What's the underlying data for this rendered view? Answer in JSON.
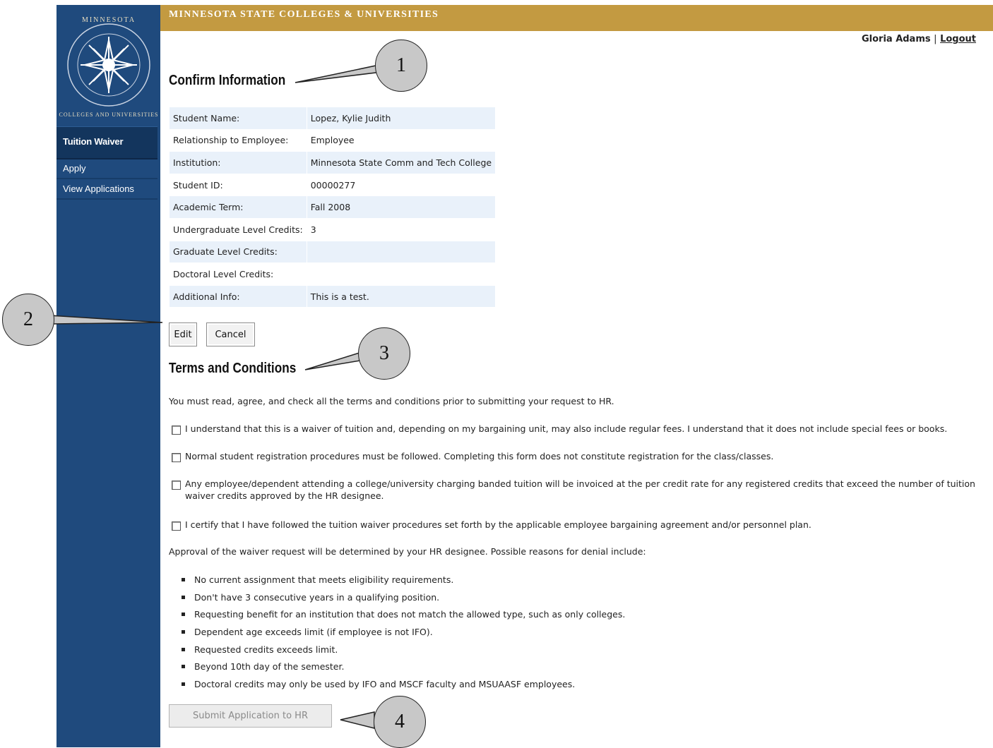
{
  "org": {
    "banner": "MINNESOTA STATE COLLEGES & UNIVERSITIES",
    "seal_text_top": "MINNESOTA",
    "seal_text_bottom": "STATE COLLEGES AND UNIVERSITIES"
  },
  "user": {
    "name": "Gloria Adams",
    "separator": "|",
    "logout": "Logout"
  },
  "sidebar": {
    "header": "Tuition Waiver",
    "items": [
      {
        "label": "Apply"
      },
      {
        "label": "View Applications"
      }
    ]
  },
  "confirm": {
    "title": "Confirm Information",
    "rows": [
      {
        "label": "Student Name:",
        "value": "Lopez, Kylie Judith"
      },
      {
        "label": "Relationship to Employee:",
        "value": "Employee"
      },
      {
        "label": "Institution:",
        "value": "Minnesota State Comm and Tech College"
      },
      {
        "label": "Student ID:",
        "value": "00000277"
      },
      {
        "label": "Academic Term:",
        "value": "Fall 2008"
      },
      {
        "label": "Undergraduate Level Credits:",
        "value": "3"
      },
      {
        "label": "Graduate Level Credits:",
        "value": ""
      },
      {
        "label": "Doctoral Level Credits:",
        "value": ""
      },
      {
        "label": "Additional Info:",
        "value": "This is a test."
      }
    ],
    "edit_label": "Edit",
    "cancel_label": "Cancel"
  },
  "terms": {
    "title": "Terms and Conditions",
    "intro": "You must read, agree, and check all the terms and conditions prior to submitting your request to HR.",
    "checks": [
      {
        "text": "I understand that this is a waiver of tuition and, depending on my bargaining unit, may also include regular fees. I understand that it does not include special fees or books.",
        "checked": false
      },
      {
        "text": "Normal student registration procedures must be followed. Completing this form does not constitute registration for the class/classes.",
        "checked": false
      },
      {
        "text": "Any employee/dependent attending a college/university charging banded tuition will be invoiced at the per credit rate for any registered credits that exceed the number of tuition waiver credits approved by the HR designee.",
        "checked": false
      },
      {
        "text": "I certify that I have followed the tuition waiver procedures set forth by the applicable employee bargaining agreement and/or personnel plan.",
        "checked": false
      }
    ],
    "approval_text": "Approval of the waiver request will be determined by your HR designee. Possible reasons for denial include:",
    "reasons": [
      "No current assignment that meets eligibility requirements.",
      "Don't have 3 consecutive years in a qualifying position.",
      "Requesting benefit for an institution that does not match the allowed type, such as only colleges.",
      "Dependent age exceeds limit (if employee is not IFO).",
      "Requested credits exceeds limit.",
      "Beyond 10th day of the semester.",
      "Doctoral credits may only be used by IFO and MSCF faculty and MSUAASF employees."
    ],
    "submit_label": "Submit Application to HR"
  },
  "callouts": [
    "1",
    "2",
    "3",
    "4"
  ],
  "colors": {
    "sidebar": "#1f4a7d",
    "banner": "#c39a41",
    "table_stripe": "#e9f1fa"
  }
}
